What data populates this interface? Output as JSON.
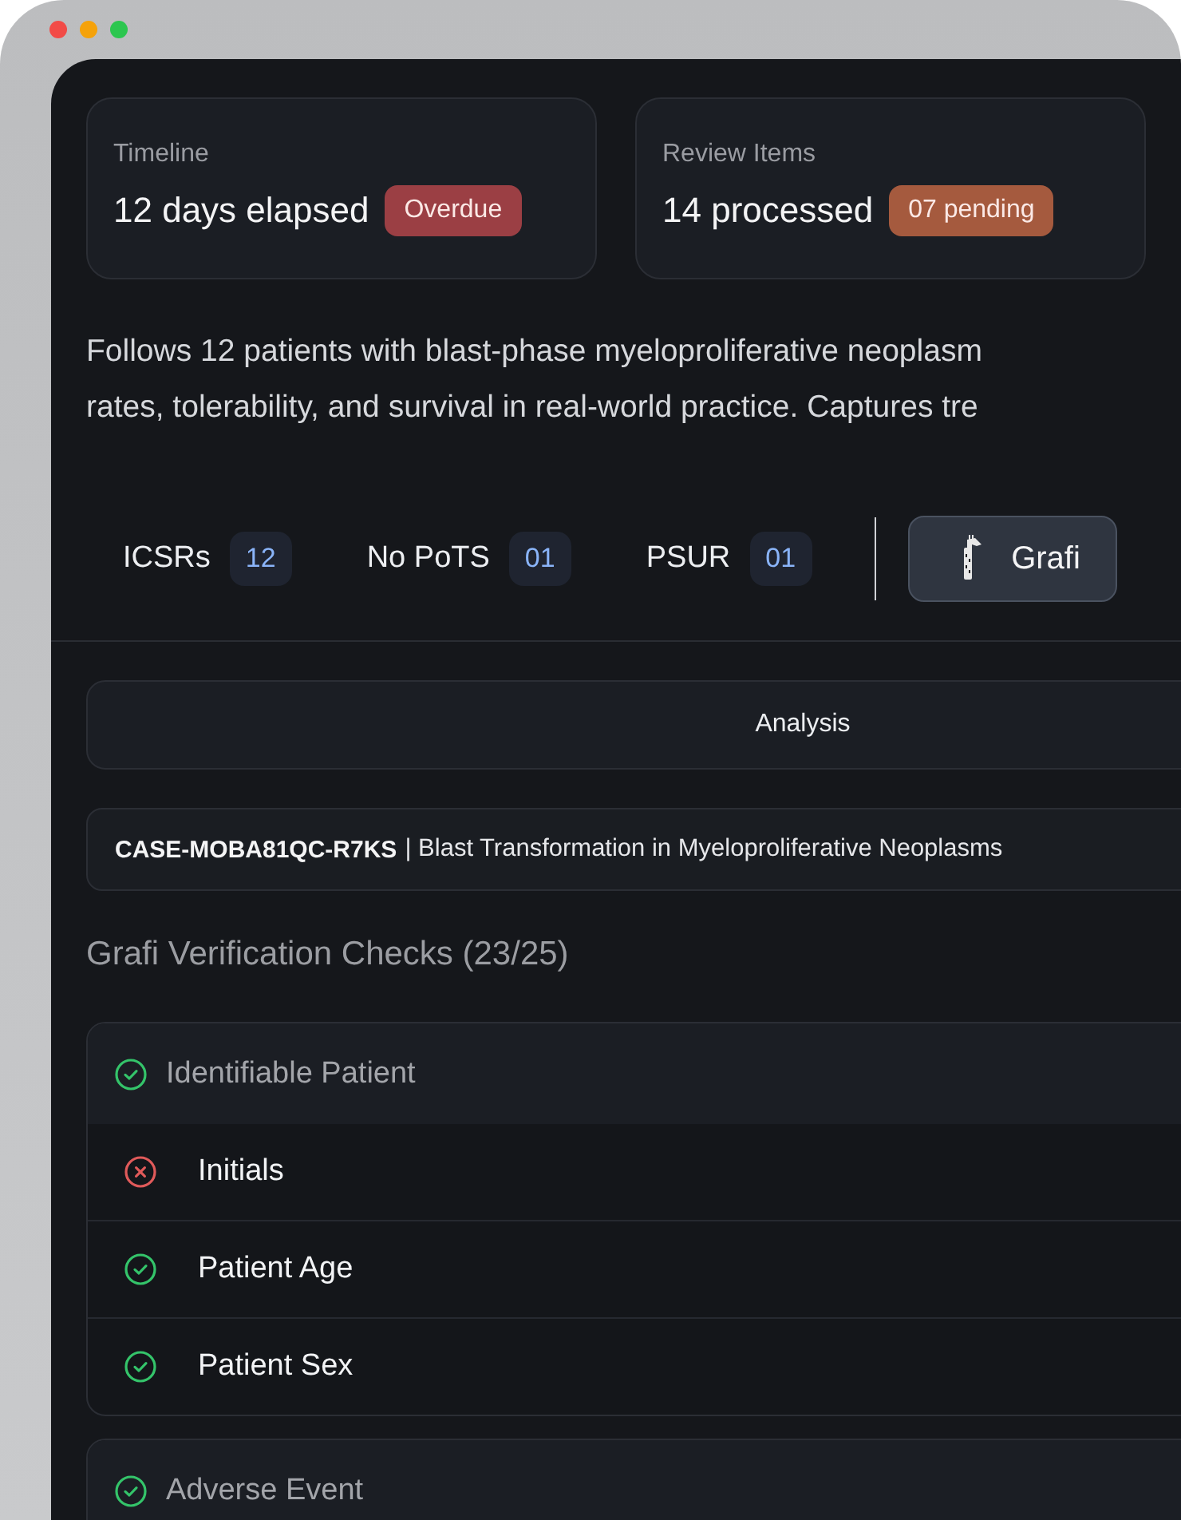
{
  "cards": [
    {
      "label": "Timeline",
      "value": "12 days elapsed",
      "badge": {
        "text": "Overdue",
        "color": "#9b3f44"
      }
    },
    {
      "label": "Review Items",
      "value": "14 processed",
      "badge": {
        "text": "07 pending",
        "color": "#a55a3e"
      }
    }
  ],
  "description": [
    "Follows 12 patients with blast-phase myeloproliferative neoplasm",
    "rates, tolerability, and survival in real-world practice. Captures tre"
  ],
  "stats": [
    {
      "label": "ICSRs",
      "count": "12"
    },
    {
      "label": "No PoTS",
      "count": "01"
    },
    {
      "label": "PSUR",
      "count": "01"
    }
  ],
  "grafi_button": "Grafi",
  "analysis_tab": "Analysis",
  "case": {
    "id": "CASE-MOBA81QC-R7KS",
    "title": "| Blast Transformation in Myeloproliferative Neoplasms"
  },
  "checks_heading": "Grafi Verification Checks (23/25)",
  "groups": [
    {
      "title": "Identifiable Patient",
      "passed": true,
      "items": [
        {
          "label": "Initials",
          "passed": false
        },
        {
          "label": "Patient Age",
          "passed": true
        },
        {
          "label": "Patient Sex",
          "passed": true
        }
      ]
    },
    {
      "title": "Adverse Event",
      "passed": true
    }
  ]
}
